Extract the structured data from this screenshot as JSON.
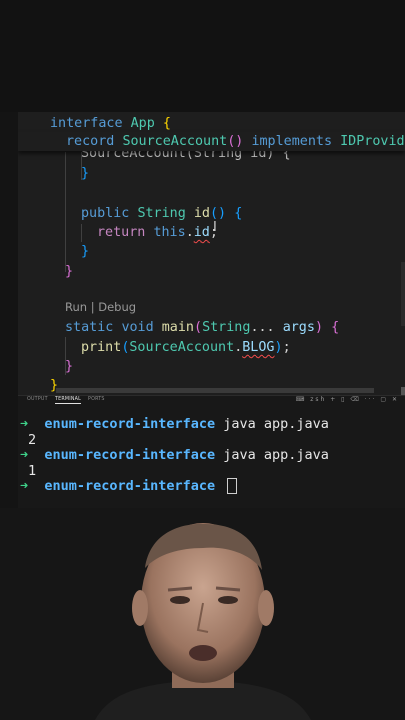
{
  "editor": {
    "lines": {
      "l1": {
        "kw": "interface",
        "name": "App",
        "brace": "{"
      },
      "sticky": {
        "kw": "record",
        "name": "SourceAccount",
        "parens": "()",
        "kw2": "implements",
        "iface": "IDProvide"
      },
      "l2_partial": "SourceAccount(String id) {",
      "l3": "}",
      "l4": {
        "kw": "public",
        "type": "String",
        "fn": "id",
        "parens": "()",
        "brace": "{"
      },
      "l5": {
        "kw": "return",
        "this": "this",
        "dot": ".",
        "field": "id",
        "semi": ";"
      },
      "l6": "}",
      "l7": "}",
      "codelens": "Run | Debug",
      "l8": {
        "kw1": "static",
        "kw2": "void",
        "fn": "main",
        "open": "(",
        "type": "String",
        "dots": "...",
        "arg": "args",
        "close": ")",
        "brace": "{"
      },
      "l9": {
        "fn": "print",
        "open": "(",
        "cls": "SourceAccount",
        "dot": ".",
        "field": "BLOG",
        "close": ")",
        "semi": ";"
      },
      "l10": "}",
      "l11": "}"
    }
  },
  "panel": {
    "tabs": [
      "OUTPUT",
      "TERMINAL",
      "PORTS"
    ],
    "active_tab": "TERMINAL",
    "toolbar_icons": [
      "zsh",
      "+",
      "split",
      "trash",
      "more",
      "maximize",
      "close"
    ],
    "terminal": [
      {
        "arrow": "➜",
        "dir": "enum-record-interface",
        "cmd": "java app.java"
      },
      {
        "output": "2"
      },
      {
        "arrow": "➜",
        "dir": "enum-record-interface",
        "cmd": "java app.java"
      },
      {
        "output": "1"
      },
      {
        "arrow": "➜",
        "dir": "enum-record-interface",
        "cmd": ""
      }
    ]
  },
  "colors": {
    "editor_bg": "#1e1e1e",
    "keyword": "#569cd6",
    "control": "#c586c0",
    "type": "#4ec9b0",
    "function": "#dcdcaa",
    "variable": "#9cdcfe",
    "prompt_arrow": "#3fd28a",
    "prompt_dir": "#59b7ff"
  }
}
